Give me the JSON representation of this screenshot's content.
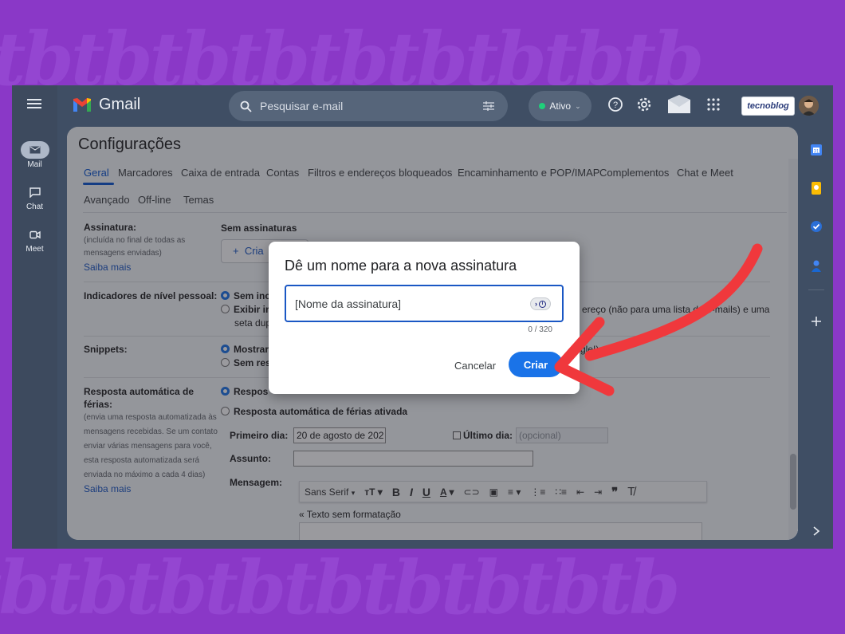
{
  "app": {
    "name": "Gmail",
    "brand_badge": "tecnoblog"
  },
  "nav": {
    "items": [
      {
        "label": "Mail",
        "icon": "mail-icon"
      },
      {
        "label": "Chat",
        "icon": "chat-icon"
      },
      {
        "label": "Meet",
        "icon": "video-icon"
      }
    ]
  },
  "search": {
    "placeholder": "Pesquisar e-mail"
  },
  "status": {
    "label": "Ativo",
    "color": "#1fd07a"
  },
  "settings": {
    "title": "Configurações",
    "tabs": [
      "Geral",
      "Marcadores",
      "Caixa de entrada",
      "Contas",
      "Filtros e endereços bloqueados",
      "Encaminhamento e POP/IMAP",
      "Complementos",
      "Chat e Meet",
      "Avançado",
      "Off-line",
      "Temas"
    ],
    "active_tab": "Geral",
    "signature": {
      "label": "Assinatura:",
      "desc_lines": [
        "(incluída no final de todas as",
        "mensagens enviadas)"
      ],
      "link": "Saiba mais",
      "none": "Sem assinaturas",
      "create_prefix": "+",
      "create_fragment": "Cria"
    },
    "indicators": {
      "label": "Indicadores de nível pessoal:",
      "opt1": "Sem inc",
      "opt2": "Exibir ir",
      "opt2_right": "ereço (não para uma lista de e-mails) e uma",
      "opt2_cont": "seta dup"
    },
    "snippets": {
      "label": "Snippets:",
      "opt1": "Mostrar",
      "opt1_right": "gle!).",
      "opt2": "Sem res"
    },
    "vacation": {
      "label_lines": [
        "Resposta automática de",
        "férias:"
      ],
      "desc_lines": [
        "(envia uma resposta automatizada às",
        "mensagens recebidas. Se um contato",
        "enviar várias mensagens para você,",
        "esta resposta automatizada será",
        "enviada no máximo a cada 4 dias)"
      ],
      "link": "Saiba mais",
      "opt_off": "Respos",
      "opt_on": "Resposta automática de férias ativada",
      "first_day_label": "Primeiro dia:",
      "first_day_value": "20 de agosto de 202",
      "last_day_label": "Último dia:",
      "last_day_placeholder": "(opcional)",
      "subject_label": "Assunto:",
      "message_label": "Mensagem:",
      "font": "Sans Serif",
      "plain_text_link": "« Texto sem formatação"
    }
  },
  "dialog": {
    "title": "Dê um nome para a nova assinatura",
    "input_value": "[Nome da assinatura]",
    "counter": "0 / 320",
    "cancel": "Cancelar",
    "create": "Criar"
  },
  "colors": {
    "accent": "#1a73e8",
    "arrow": "#f0383c",
    "background": "#8a38c7",
    "header": "#3f4e64"
  }
}
